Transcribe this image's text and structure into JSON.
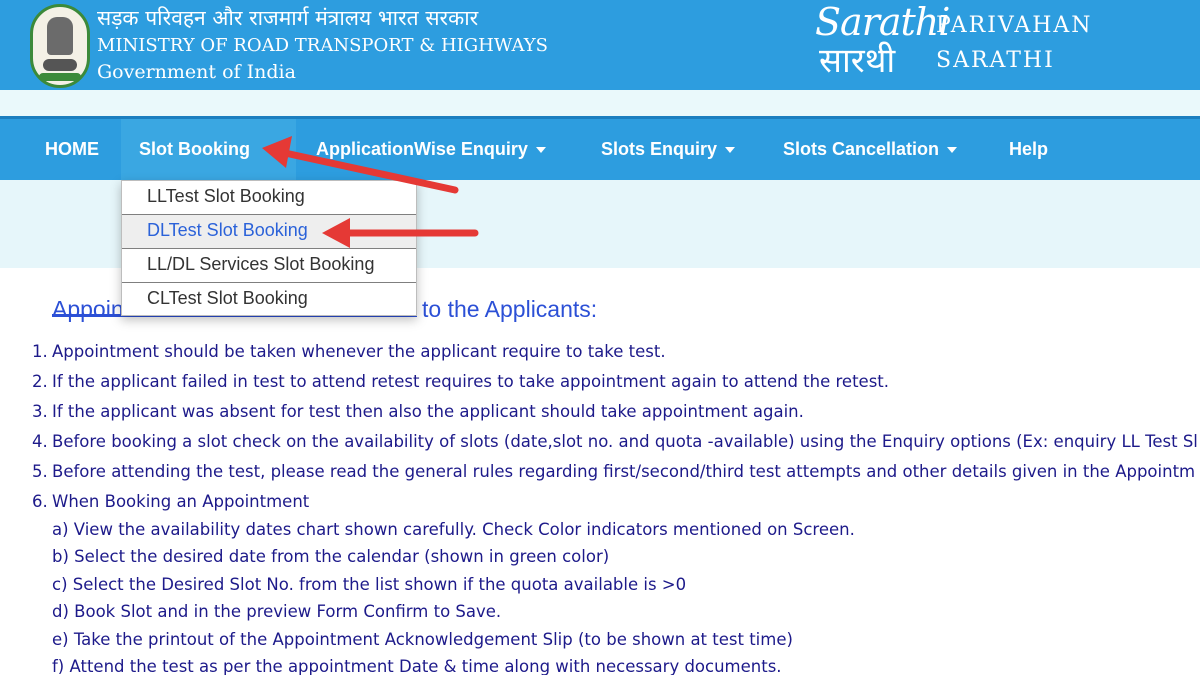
{
  "header": {
    "hindi_title": "सड़क परिवहन और राजमार्ग मंत्रालय भारत सरकार",
    "ministry_en": "MINISTRY OF ROAD TRANSPORT & HIGHWAYS",
    "government": "Government of India",
    "logo_en": "Sarathi",
    "logo_hi": "सारथी",
    "brand_line1": "PARIVAHAN",
    "brand_line2": "SARATHI",
    "emblem_icon": "national-emblem-icon"
  },
  "nav": {
    "home": "HOME",
    "slot_booking": "Slot Booking",
    "application_enquiry": "ApplicationWise Enquiry",
    "slots_enquiry": "Slots Enquiry",
    "slots_cancellation": "Slots Cancellation",
    "help": "Help"
  },
  "dropdown": {
    "items": [
      "LLTest Slot Booking",
      "DLTest Slot Booking",
      "LL/DL Services Slot Booking",
      "CLTest Slot Booking"
    ],
    "highlighted_index": 1
  },
  "content": {
    "title_start": "Appoin",
    "title_end": "to the Applicants:",
    "items": [
      {
        "num": "1.",
        "text": "Appointment should be taken whenever the applicant require to take test."
      },
      {
        "num": "2.",
        "text": "If the applicant failed in test to attend retest requires to take appointment again to attend the retest."
      },
      {
        "num": "3.",
        "text": "If the applicant was absent for test then also the applicant should take appointment again."
      },
      {
        "num": "4.",
        "text": "Before booking a slot check on the availability of slots (date,slot no. and quota -available) using the Enquiry options (Ex: enquiry LL Test Sl"
      },
      {
        "num": "5.",
        "text": "Before attending the test, please read the general rules regarding first/second/third test attempts and other details given in the Appointm"
      },
      {
        "num": "6.",
        "text": "When Booking an Appointment"
      }
    ],
    "subitems": [
      "a) View the availability dates chart shown carefully. Check Color indicators mentioned on Screen.",
      "b) Select the desired date from the calendar (shown in green color)",
      "c) Select the Desired Slot No. from the list shown if the quota available is >0",
      "d) Book Slot and in the preview Form Confirm to Save.",
      "e) Take the printout of the Appointment Acknowledgement Slip (to be shown at test time)",
      "f) Attend the test as per the appointment Date & time along with necessary documents."
    ]
  },
  "colors": {
    "header_blue": "#2d9ddf",
    "annotation_red": "#e53935",
    "text_navy": "#1d1a8a",
    "title_blue": "#2c50d6"
  }
}
